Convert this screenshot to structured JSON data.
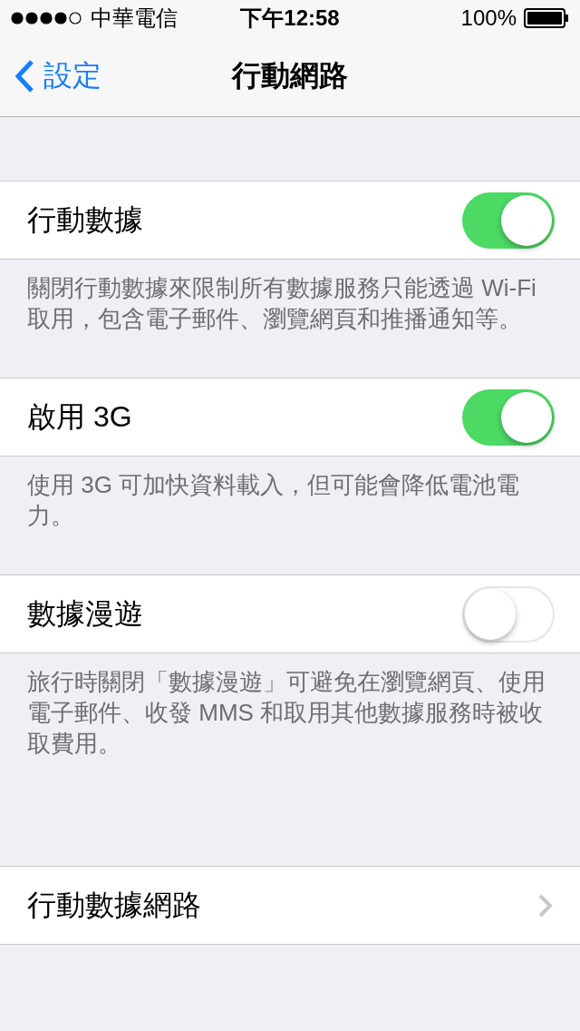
{
  "status_bar": {
    "carrier": "中華電信",
    "time": "下午12:58",
    "battery": "100%"
  },
  "nav": {
    "back": "設定",
    "title": "行動網路"
  },
  "groups": [
    {
      "sections": [
        {
          "rows": [
            {
              "kind": "toggle",
              "label": "行動數據",
              "on": true
            }
          ],
          "footer": "關閉行動數據來限制所有數據服務只能透過 Wi-Fi 取用，包含電子郵件、瀏覽網頁和推播通知等。"
        },
        {
          "rows": [
            {
              "kind": "toggle",
              "label": "啟用 3G",
              "on": true
            }
          ],
          "footer": "使用 3G 可加快資料載入，但可能會降低電池電力。"
        },
        {
          "rows": [
            {
              "kind": "toggle",
              "label": "數據漫遊",
              "on": false
            }
          ],
          "footer": "旅行時關閉「數據漫遊」可避免在瀏覽網頁、使用電子郵件、收發 MMS 和取用其他數據服務時被收取費用。"
        }
      ]
    },
    {
      "sections": [
        {
          "rows": [
            {
              "kind": "disclosure",
              "label": "行動數據網路"
            }
          ]
        }
      ]
    }
  ]
}
